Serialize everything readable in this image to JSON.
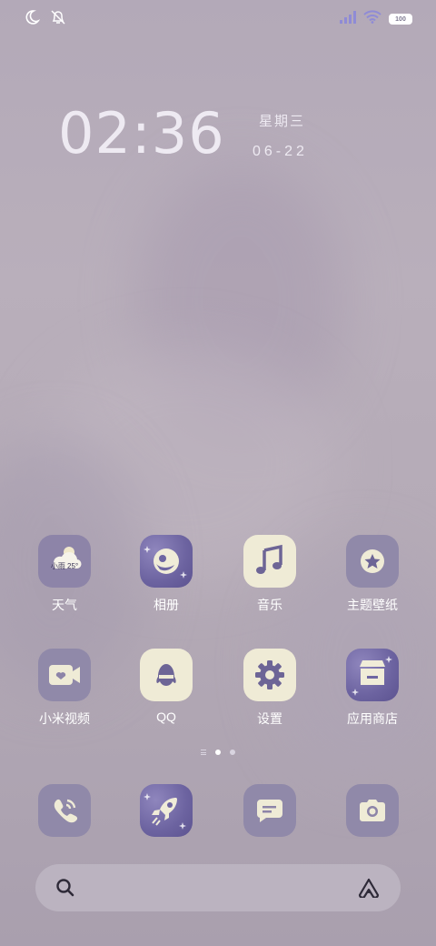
{
  "status_bar": {
    "battery_text": "100",
    "icons": [
      "moon-icon",
      "alarm-off-icon",
      "signal-icon",
      "wifi-icon",
      "battery-icon"
    ]
  },
  "clock": {
    "time": "02:36",
    "weekday": "星期三",
    "date": "06-22"
  },
  "apps": [
    {
      "label": "天气",
      "icon": "weather-icon",
      "widget_text": "小雨 25°"
    },
    {
      "label": "相册",
      "icon": "gallery-icon"
    },
    {
      "label": "音乐",
      "icon": "music-icon"
    },
    {
      "label": "主题壁纸",
      "icon": "themes-icon"
    },
    {
      "label": "小米视频",
      "icon": "video-icon"
    },
    {
      "label": "QQ",
      "icon": "qq-icon"
    },
    {
      "label": "设置",
      "icon": "settings-icon"
    },
    {
      "label": "应用商店",
      "icon": "app-store-icon"
    }
  ],
  "dock": [
    {
      "icon": "phone-icon"
    },
    {
      "icon": "rocket-icon"
    },
    {
      "icon": "messages-icon"
    },
    {
      "icon": "camera-icon"
    }
  ],
  "pager": {
    "pages": 2,
    "active_index": 0
  },
  "search_bar": {
    "icons": [
      "search-icon",
      "ai-assistant-icon"
    ]
  }
}
